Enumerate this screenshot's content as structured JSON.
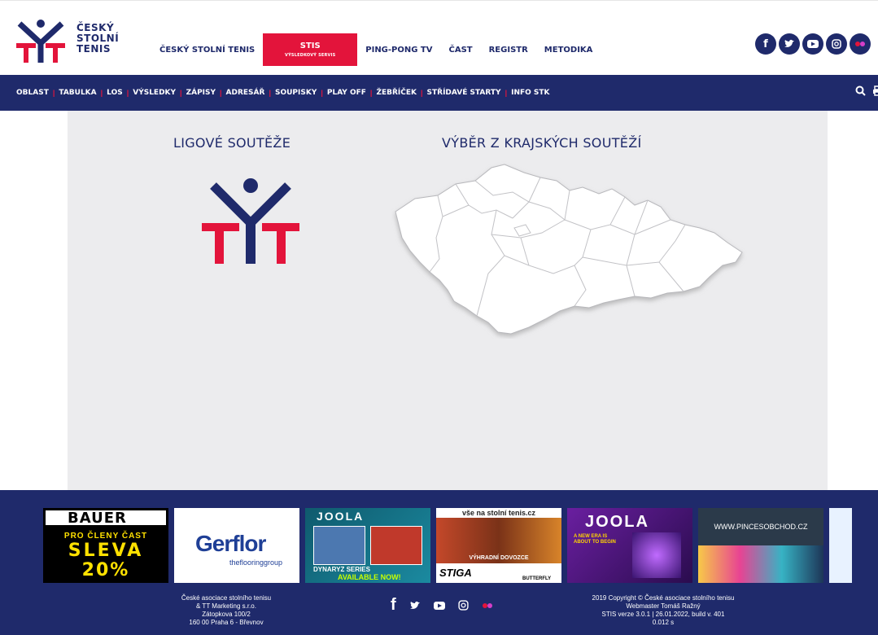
{
  "header": {
    "logo_lines": [
      "ČESKÝ",
      "STOLNÍ",
      "TENIS"
    ],
    "nav": [
      {
        "label": "ČESKÝ STOLNÍ TENIS"
      },
      {
        "label": "STIS",
        "sub": "VÝSLEDKOVÝ SERVIS",
        "active": true
      },
      {
        "label": "PING-PONG TV"
      },
      {
        "label": "ČAST"
      },
      {
        "label": "REGISTR"
      },
      {
        "label": "METODIKA"
      }
    ],
    "social": [
      "facebook-icon",
      "twitter-icon",
      "youtube-icon",
      "instagram-icon",
      "flickr-icon"
    ]
  },
  "subnav": {
    "items": [
      "OBLAST",
      "TABULKA",
      "LOS",
      "VÝSLEDKY",
      "ZÁPISY",
      "ADRESÁŘ",
      "SOUPISKY",
      "PLAY OFF",
      "ŽEBŘÍČEK",
      "STŘÍDAVÉ STARTY",
      "INFO STK"
    ],
    "separator": "|",
    "tools": [
      "search-icon",
      "print-icon"
    ]
  },
  "main": {
    "left_heading": "LIGOVÉ SOUTĚŽE",
    "right_heading": "VÝBĚR Z KRAJSKÝCH SOUTĚŽÍ"
  },
  "footer": {
    "sponsors": {
      "bauer": {
        "brand": "BAUER",
        "line1": "PRO ČLENY ČAST",
        "line2": "SLEVA",
        "line3": "20%"
      },
      "gerflor": {
        "brand": "Gerflor",
        "tag": "theflooringgroup"
      },
      "joola1": {
        "brand": "JOOLA",
        "line1": "DYNARYZ SERIES",
        "line2": "AVAILABLE NOW!"
      },
      "vse": {
        "brand": "vše na stolní tenis.cz",
        "line1": "VÝHRADNÍ DOVOZCE",
        "line2": "STIGA",
        "line3": "BUTTERFLY"
      },
      "joola2": {
        "brand": "JOOLA",
        "line1": "A NEW ERA IS ABOUT TO BEGIN"
      },
      "pinces": {
        "brand": "WWW.PINCESOBCHOD.CZ"
      }
    },
    "left_lines": [
      "České asociace stolního tenisu",
      "& TT Marketing s.r.o.",
      "Zátopkova 100/2",
      "160 00 Praha 6 - Břevnov"
    ],
    "right_lines": [
      "2019 Copyright © České asociace stolního tenisu",
      "Webmaster Tomáš Ražný",
      "STIS verze 3.0.1 | 26.01.2022, build v. 401",
      "0.012 s"
    ],
    "social": [
      "facebook-icon",
      "twitter-icon",
      "youtube-icon",
      "instagram-icon",
      "flickr-icon"
    ]
  },
  "colors": {
    "navy": "#1f2a6b",
    "red": "#e3143b",
    "content_bg": "#ececee"
  }
}
